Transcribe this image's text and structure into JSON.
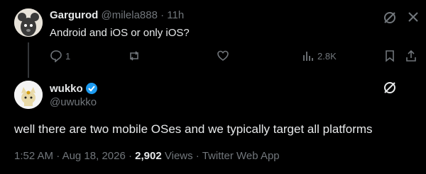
{
  "reply": {
    "display_name": "Gargurod",
    "handle": "@milela888",
    "separator": "·",
    "time": "11h",
    "text": "Android and iOS or only iOS?",
    "reply_count": "1",
    "views": "2.8K"
  },
  "main": {
    "display_name": "wukko",
    "handle": "@uwukko",
    "text": "well there are two mobile OSes and we typically target all platforms",
    "time": "1:52 AM",
    "date": "Aug 18, 2026",
    "views_count": "2,902",
    "views_label": "Views",
    "source": "Twitter Web App",
    "dot": "·"
  },
  "colors": {
    "background": "#000000",
    "text": "#e7e9ea",
    "muted": "#71767b",
    "verified": "#1d9bf0"
  },
  "icons": [
    "grok-icon",
    "more-icon",
    "reply-icon",
    "retweet-icon",
    "like-icon",
    "views-icon",
    "bookmark-icon",
    "share-icon",
    "verified-badge-icon"
  ]
}
